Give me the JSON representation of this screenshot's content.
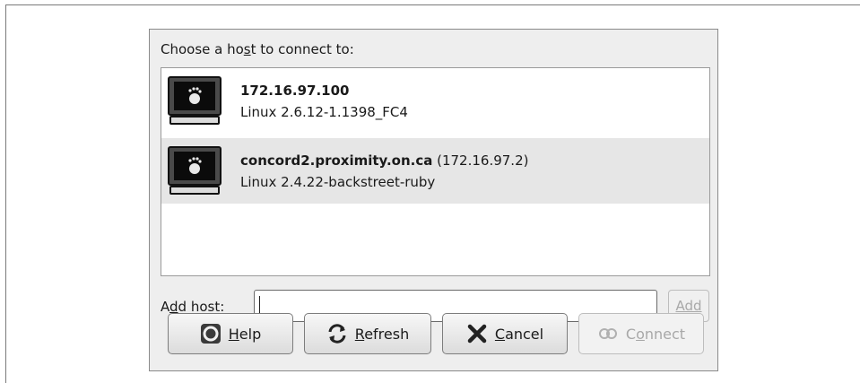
{
  "prompt": {
    "before": "Choose a ho",
    "mnemonic": "s",
    "after": "t to connect to:"
  },
  "hosts": [
    {
      "name": "172.16.97.100",
      "ip": "",
      "os": "Linux 2.6.12-1.1398_FC4"
    },
    {
      "name": "concord2.proximity.on.ca",
      "ip": " (172.16.97.2)",
      "os": "Linux 2.4.22-backstreet-ruby"
    }
  ],
  "add_host": {
    "label_before": "A",
    "label_mnemonic": "d",
    "label_after": "d host:",
    "value": "",
    "button": "Add"
  },
  "buttons": {
    "help": {
      "mnemonic": "H",
      "rest": "elp"
    },
    "refresh": {
      "mnemonic": "R",
      "rest": "efresh"
    },
    "cancel": {
      "mnemonic": "C",
      "rest": "ancel"
    },
    "connect": {
      "before": "C",
      "mnemonic": "o",
      "rest": "nnect"
    }
  },
  "icons": {
    "host": "computer-monitor-icon",
    "help": "lifebuoy-icon",
    "refresh": "refresh-arrows-icon",
    "cancel": "x-icon",
    "connect": "connect-icon"
  }
}
